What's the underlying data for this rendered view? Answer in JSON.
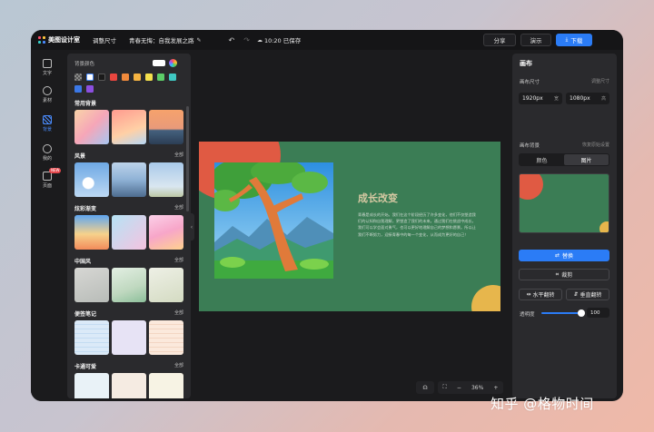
{
  "app": {
    "name": "美图设计室"
  },
  "topbar": {
    "resize_label": "调整尺寸",
    "doc_title": "青春无悔：自我发展之路",
    "save_status": "10:20 已保存",
    "share_label": "分享",
    "present_label": "演示",
    "download_label": "下载"
  },
  "leftnav": {
    "items": [
      {
        "label": "文字",
        "icon": "text-icon"
      },
      {
        "label": "素材",
        "icon": "assets-icon"
      },
      {
        "label": "背景",
        "icon": "background-icon"
      },
      {
        "label": "我的",
        "icon": "user-icon"
      },
      {
        "label": "页面",
        "icon": "pages-icon"
      }
    ],
    "badge": "NEW"
  },
  "bgpanel": {
    "color_label": "背景颜色",
    "swatches": [
      "#ffffff",
      "#1a1a1a",
      "#e8463f",
      "#f08a3c",
      "#f5b342",
      "#f4e04d",
      "#5ccc68",
      "#3fc7c2",
      "#3b78e7",
      "#8c4fe0"
    ],
    "all_label": "全部",
    "sections": [
      {
        "title": "常用背景"
      },
      {
        "title": "风景"
      },
      {
        "title": "炫彩渐变"
      },
      {
        "title": "中国风"
      },
      {
        "title": "便签笔记"
      },
      {
        "title": "卡通可爱"
      }
    ]
  },
  "slide": {
    "title": "成长改变",
    "body": "青春是成长的开始。我们在这个阶段经历了许多变化，他们不仅塑造我们的认知和自我理解，更塑造了我们的未来。通过我们在挑战中成长，我们可以学会面对勇气，也可以更好地理解自己的梦想和愿景。所以让我们不断努力，迎接青春中的每一个变化，从而成为更好的自己！",
    "bg_color": "#3b7d55"
  },
  "zoom": {
    "value": "36%"
  },
  "rpanel": {
    "title": "画布",
    "size_label": "画布尺寸",
    "size_hint": "调整尺寸",
    "width_value": "1920px",
    "width_unit": "宽",
    "height_value": "1080px",
    "height_unit": "高",
    "bg_label": "画布背景",
    "bg_hint": "恢复原始设置",
    "tab_color": "颜色",
    "tab_image": "图片",
    "replace_label": "替换",
    "crop_label": "裁剪",
    "flip_h_label": "水平翻转",
    "flip_v_label": "垂直翻转",
    "opacity_label": "透明度",
    "opacity_value": "100",
    "opacity_level": 1.0
  },
  "watermark": "知乎 @格物时间"
}
